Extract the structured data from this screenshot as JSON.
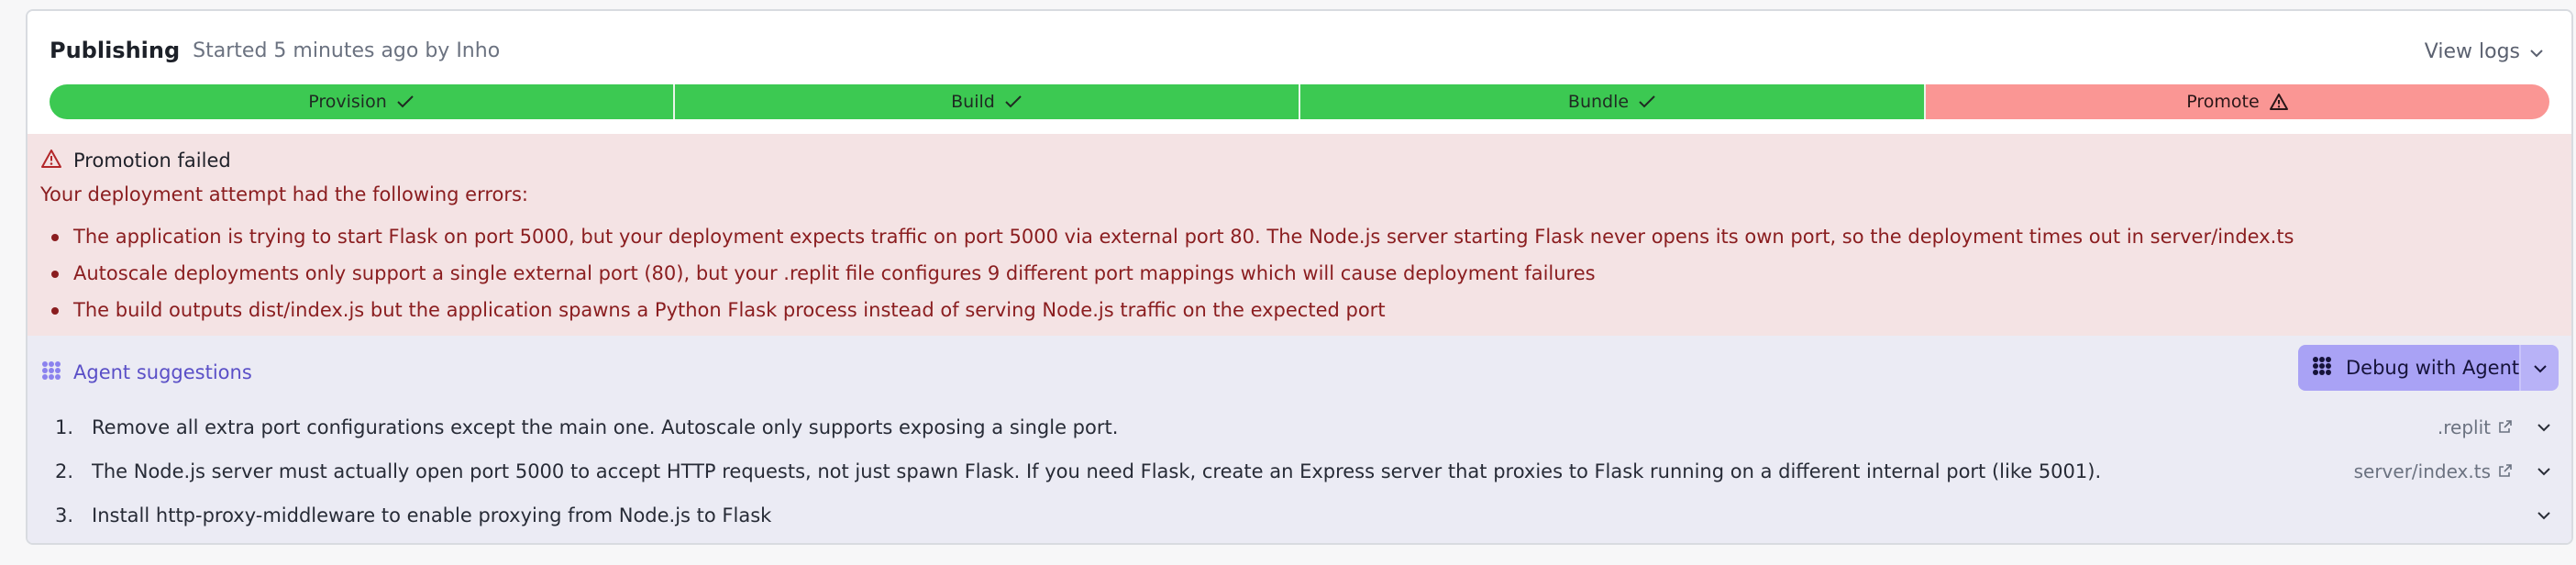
{
  "header": {
    "title": "Publishing",
    "meta": "Started 5 minutes ago by Inho",
    "view_logs": "View logs"
  },
  "steps": [
    {
      "label": "Provision",
      "status": "success",
      "icon": "check-icon"
    },
    {
      "label": "Build",
      "status": "success",
      "icon": "check-icon"
    },
    {
      "label": "Bundle",
      "status": "success",
      "icon": "check-icon"
    },
    {
      "label": "Promote",
      "status": "failed",
      "icon": "warning-icon"
    }
  ],
  "error": {
    "title": "Promotion failed",
    "intro": "Your deployment attempt had the following errors:",
    "items": [
      "The application is trying to start Flask on port 5000, but your deployment expects traffic on port 5000 via external port 80. The Node.js server starting Flask never opens its own port, so the deployment times out in server/index.ts",
      "Autoscale deployments only support a single external port (80), but your .replit file configures 9 different port mappings which will cause deployment failures",
      "The build outputs dist/index.js but the application spawns a Python Flask process instead of serving Node.js traffic on the expected port"
    ]
  },
  "agent": {
    "title": "Agent suggestions",
    "debug_button": "Debug with Agent",
    "suggestions": [
      {
        "num": "1.",
        "text": "Remove all extra port configurations except the main one. Autoscale only supports exposing a single port.",
        "file": ".replit"
      },
      {
        "num": "2.",
        "text": "The Node.js server must actually open port 5000 to accept HTTP requests, not just spawn Flask. If you need Flask, create an Express server that proxies to Flask running on a different internal port (like 5001).",
        "file": "server/index.ts"
      },
      {
        "num": "3.",
        "text": "Install http-proxy-middleware to enable proxying from Node.js to Flask",
        "file": ""
      }
    ]
  },
  "colors": {
    "success": "#3cc952",
    "failed": "#fa9694",
    "error_bg": "#f4e3e4",
    "error_text": "#8a1d1f",
    "agent_bg": "#ebebf4",
    "agent_accent": "#5a4fc7",
    "button_bg": "#a9a2f5"
  }
}
